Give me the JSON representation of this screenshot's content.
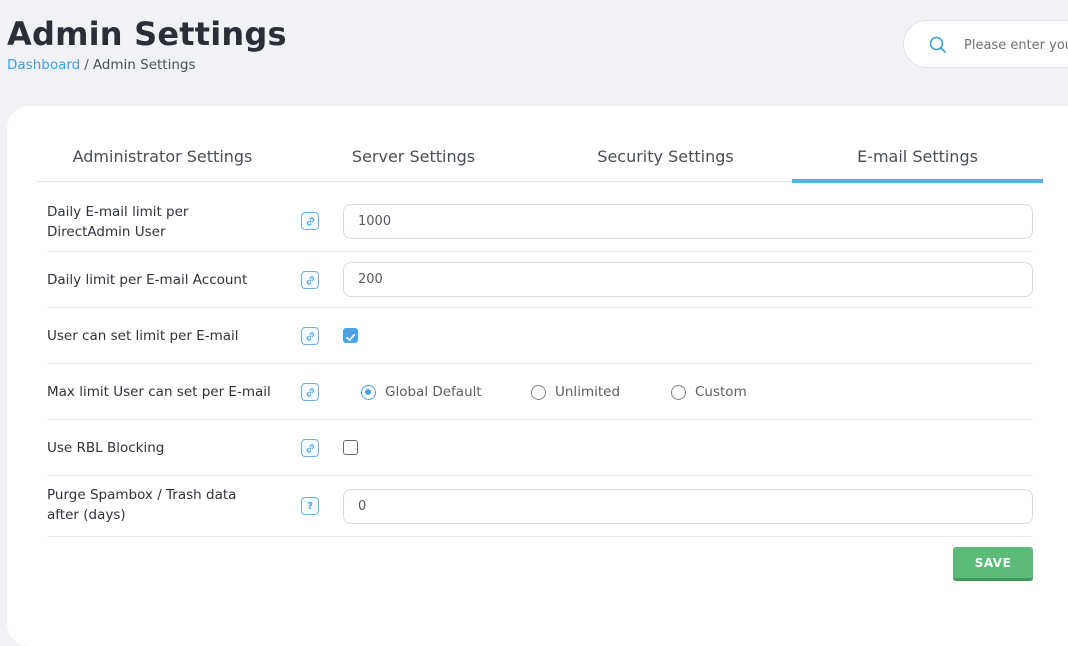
{
  "header": {
    "title": "Admin Settings",
    "breadcrumb": {
      "link": "Dashboard",
      "separator": "/",
      "current": "Admin Settings"
    }
  },
  "search": {
    "placeholder": "Please enter your search",
    "value": ""
  },
  "tabs": [
    {
      "label": "Administrator Settings",
      "active": false
    },
    {
      "label": "Server Settings",
      "active": false
    },
    {
      "label": "Security Settings",
      "active": false
    },
    {
      "label": "E-mail Settings",
      "active": true
    }
  ],
  "settings": {
    "daily_email_limit": {
      "label_line1": "Daily E-mail limit per",
      "label_line2": "DirectAdmin User",
      "value": "1000",
      "help_icon": "link-icon"
    },
    "daily_account_limit": {
      "label": "Daily limit per E-mail Account",
      "value": "200",
      "help_icon": "link-icon"
    },
    "user_set_limit": {
      "label": "User can set limit per E-mail",
      "checked": true,
      "help_icon": "link-icon"
    },
    "max_limit": {
      "label": "Max limit User can set per E-mail",
      "help_icon": "link-icon",
      "options": [
        "Global Default",
        "Unlimited",
        "Custom"
      ],
      "selected": "Global Default"
    },
    "rbl_blocking": {
      "label": "Use RBL Blocking",
      "checked": false,
      "help_icon": "link-icon"
    },
    "purge_spambox": {
      "label_line1": "Purge Spambox / Trash data",
      "label_line2": "after (days)",
      "value": "0",
      "help_icon": "question-icon",
      "help_glyph": "?"
    }
  },
  "actions": {
    "save_label": "SAVE"
  },
  "colors": {
    "accent": "#5aaee3",
    "link": "#3a9fe0",
    "save": "#5bbb78",
    "background": "#f1f2f6"
  }
}
